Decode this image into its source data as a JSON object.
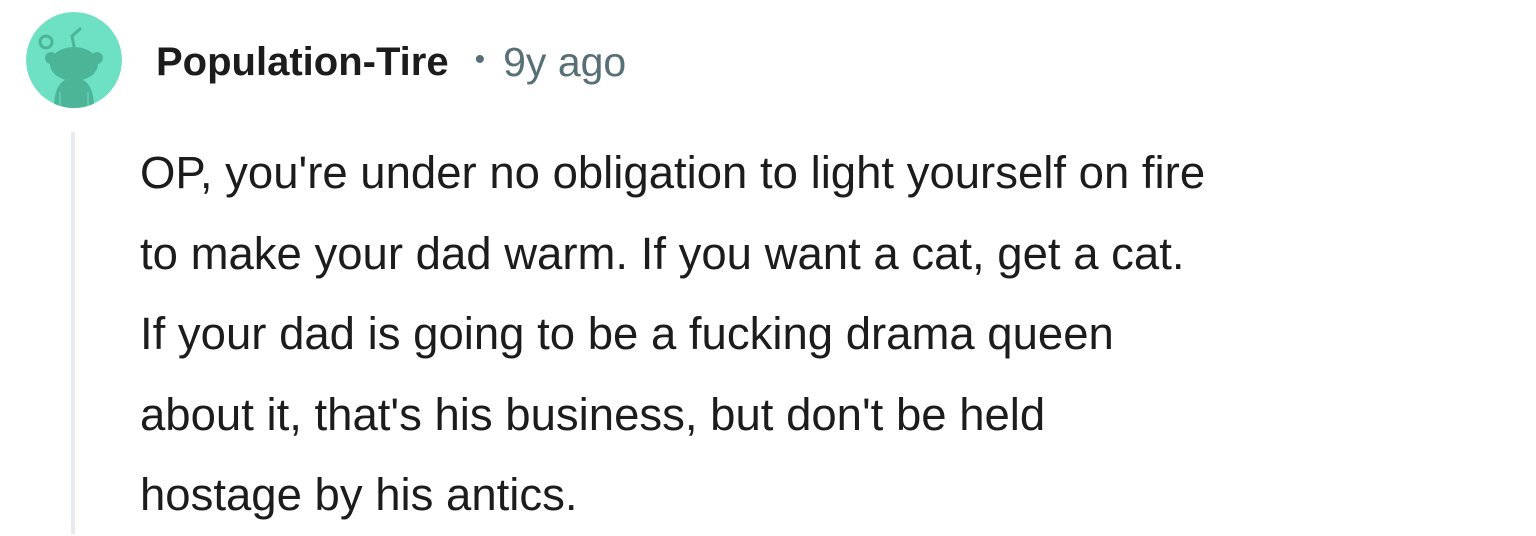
{
  "comment": {
    "author": "Population-Tire",
    "separator": "•",
    "timestamp": "9y ago",
    "avatar_icon": "reddit-snoo-avatar-icon",
    "colors": {
      "avatar_bg": "#6ee0c4",
      "avatar_figure": "#4cb597",
      "meta_text": "#576f76",
      "body_text": "#1c1c1c",
      "thread_line": "#e5ebee"
    },
    "body_lines": [
      "OP, you're under no obligation to light yourself on fire",
      "to make your dad warm. If you want a cat, get a cat.",
      "If your dad is going to be a fucking drama queen",
      "about it, that's his business, but don't be held",
      "hostage by his antics."
    ]
  }
}
